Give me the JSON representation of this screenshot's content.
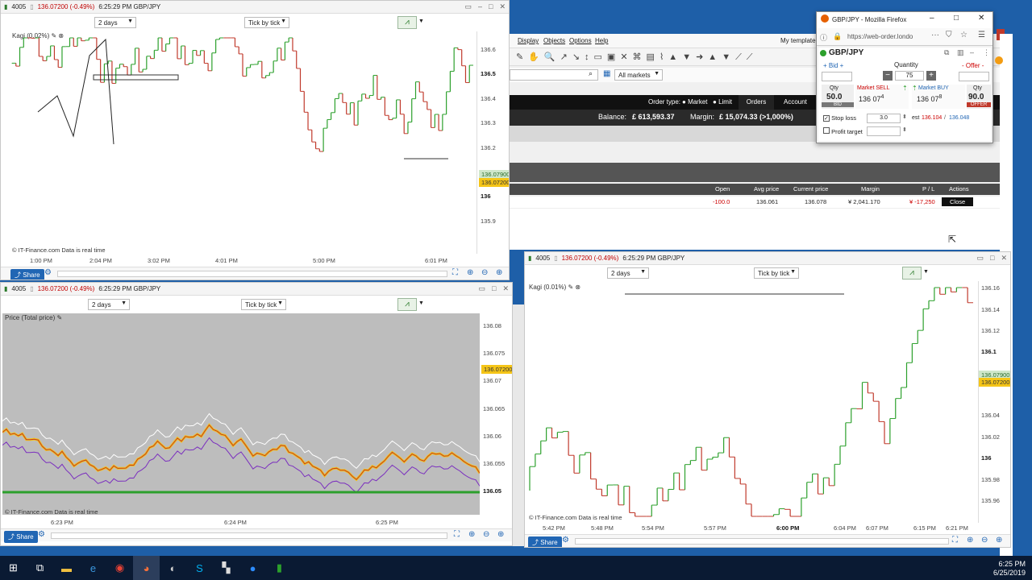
{
  "colors": {
    "desktop": "#1e5fa8",
    "up": "#2ca02c",
    "down": "#c0392b",
    "brand": "#2166b4",
    "price_yellow": "#f5c518"
  },
  "chart1": {
    "id": "4005",
    "price_change": "136.07200 (-0.49%)",
    "time_pair": "6:25:29 PM GBP/JPY",
    "period": "2 days",
    "tick": "Tick by tick",
    "indicator": "Kagi (0.02%)",
    "y_ticks": [
      "136.6",
      "136.5",
      "136.4",
      "136.3",
      "136.2",
      "136.07900",
      "136.07200",
      "136",
      "135.9"
    ],
    "x_ticks": [
      "1:00 PM",
      "2:04 PM",
      "3:02 PM",
      "4:01 PM",
      "5:00 PM",
      "6:01 PM"
    ],
    "footer": "© IT-Finance.com Data is real time",
    "share": "Share"
  },
  "chart2": {
    "id": "4005",
    "price_change": "136.07200 (-0.49%)",
    "time_pair": "6:25:29 PM GBP/JPY",
    "period": "2 days",
    "tick": "Tick by tick",
    "indicator": "Price (Total price)",
    "y_ticks": [
      "136.08",
      "136.075",
      "136.07200",
      "136.07",
      "136.065",
      "136.06",
      "136.055",
      "136.05"
    ],
    "x_ticks": [
      "6:23 PM",
      "6:24 PM",
      "6:25 PM"
    ],
    "footer": "© IT-Finance.com Data is real time",
    "share": "Share"
  },
  "chart3": {
    "id": "4005",
    "price_change": "136.07200 (-0.49%)",
    "time_pair": "6:25:29 PM GBP/JPY",
    "period": "2 days",
    "tick": "Tick by tick",
    "indicator": "Kagi (0.01%)",
    "y_ticks": [
      "136.16",
      "136.14",
      "136.12",
      "136.1",
      "136.07900",
      "136.07200",
      "136.04",
      "136.02",
      "136",
      "135.98",
      "135.96"
    ],
    "x_ticks": [
      "5:42 PM",
      "5:48 PM",
      "5:54 PM",
      "5:57 PM",
      "6:00 PM",
      "6:04 PM",
      "6:07 PM",
      "6:15 PM",
      "6:21 PM"
    ],
    "footer": "© IT-Finance.com Data is real time",
    "share": "Share"
  },
  "platform": {
    "menu": [
      "Display",
      "Objects",
      "Options",
      "Help"
    ],
    "my_template": "My template",
    "all_markets": "All markets",
    "order_type_label": "Order type:",
    "market": "Market",
    "limit": "Limit",
    "orders": "Orders",
    "account": "Account",
    "balance_label": "Balance:",
    "balance_value": "£ 613,593.37",
    "margin_label": "Margin:",
    "margin_value": "£ 15,074.33 (>1,000%)",
    "table_headers": [
      "Open",
      "Avg price",
      "Current price",
      "Margin",
      "P / L",
      "Actions"
    ],
    "row": {
      "open": "-100.0",
      "avg": "136.061",
      "current": "136.078",
      "margin": "¥ 2,041.170",
      "pl": "¥ -17,250",
      "action": "Close"
    }
  },
  "order_window": {
    "title": "GBP/JPY - Mozilla Firefox",
    "url": "https://web-order.londo",
    "instrument": "GBP/JPY",
    "bid_label": "+ Bid +",
    "offer_label": "- Offer -",
    "quantity_label": "Quantity",
    "quantity": "75",
    "sell_label": "Market SELL",
    "buy_label": "Market BUY",
    "qty": "Qty",
    "sell_qty": "50.0",
    "buy_qty": "90.0",
    "sell_price_big": "136 07",
    "sell_price_sup": "4",
    "buy_price_big": "136 07",
    "buy_price_sup": "8",
    "bid": "BID",
    "offer": "OFFER",
    "stop_loss_label": "Stop loss",
    "stop_loss_value": "3.0",
    "est_label": "est",
    "est_value1": "136.104",
    "est_value2": "136.048",
    "profit_target_label": "Profit target"
  },
  "taskbar": {
    "time": "6:25 PM",
    "date": "6/25/2019"
  }
}
